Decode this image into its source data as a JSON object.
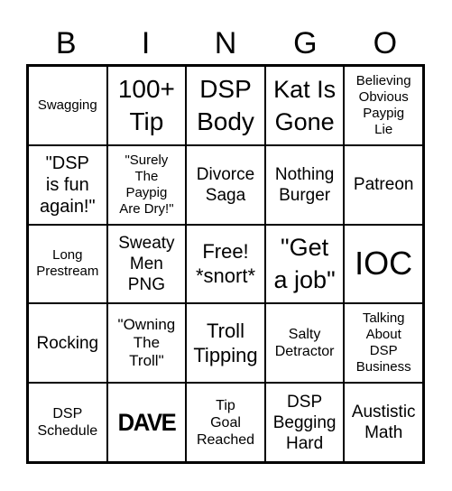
{
  "header": {
    "letters": [
      "B",
      "I",
      "N",
      "G",
      "O"
    ]
  },
  "grid": {
    "rows": [
      [
        {
          "text": "Swagging"
        },
        {
          "text": "100+\nTip"
        },
        {
          "text": "DSP\nBody"
        },
        {
          "text": "Kat Is\nGone"
        },
        {
          "text": "Believing\nObvious\nPaypig\nLie"
        }
      ],
      [
        {
          "text": "\"DSP\nis fun\nagain!\""
        },
        {
          "text": "\"Surely\nThe\nPaypig\nAre Dry!\""
        },
        {
          "text": "Divorce\nSaga"
        },
        {
          "text": "Nothing\nBurger"
        },
        {
          "text": "Patreon"
        }
      ],
      [
        {
          "text": "Long\nPrestream"
        },
        {
          "text": "Sweaty\nMen\nPNG"
        },
        {
          "text": "Free!\n*snort*"
        },
        {
          "text": "\"Get\na job\""
        },
        {
          "text": "IOC"
        }
      ],
      [
        {
          "text": "Rocking"
        },
        {
          "text": "\"Owning\nThe\nTroll\""
        },
        {
          "text": "Troll\nTipping"
        },
        {
          "text": "Salty\nDetractor"
        },
        {
          "text": "Talking\nAbout\nDSP\nBusiness"
        }
      ],
      [
        {
          "text": "DSP\nSchedule"
        },
        {
          "text": "DAVE",
          "type": "logo-image"
        },
        {
          "text": "Tip\nGoal\nReached"
        },
        {
          "text": "DSP\nBegging\nHard"
        },
        {
          "text": "Austistic\nMath"
        }
      ]
    ]
  },
  "colors": {
    "background": "#ffffff",
    "lines": "#000000",
    "text": "#000000"
  }
}
